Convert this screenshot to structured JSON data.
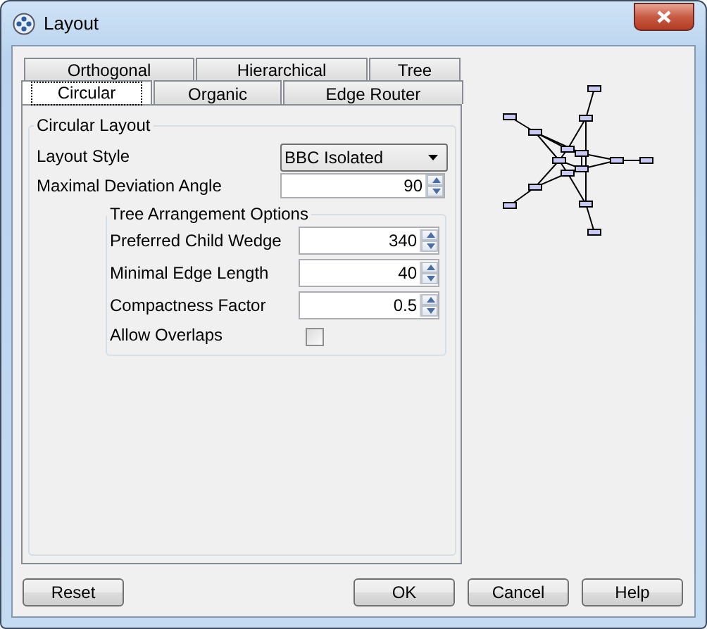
{
  "window": {
    "title": "Layout"
  },
  "tab_rows": [
    [
      {
        "label": "Orthogonal",
        "selected": false
      },
      {
        "label": "Hierarchical",
        "selected": false
      },
      {
        "label": "Tree",
        "selected": false
      }
    ],
    [
      {
        "label": "Circular",
        "selected": true
      },
      {
        "label": "Organic",
        "selected": false
      },
      {
        "label": "Edge Router",
        "selected": false
      }
    ]
  ],
  "circular_layout": {
    "title": "Circular Layout",
    "layout_style": {
      "label": "Layout Style",
      "value": "BBC Isolated"
    },
    "maximal_deviation_angle": {
      "label": "Maximal Deviation Angle",
      "value": "90"
    },
    "tree_arrangement": {
      "title": "Tree Arrangement Options",
      "fields": [
        {
          "kind": "spinner",
          "label": "Preferred Child Wedge",
          "value": "340"
        },
        {
          "kind": "spinner",
          "label": "Minimal Edge Length",
          "value": "40"
        },
        {
          "kind": "spinner",
          "label": "Compactness Factor",
          "value": "0.5"
        },
        {
          "kind": "checkbox",
          "label": "Allow Overlaps",
          "checked": false
        }
      ]
    }
  },
  "buttons_left": [
    "Reset"
  ],
  "buttons_right": [
    "OK",
    "Cancel",
    "Help"
  ]
}
